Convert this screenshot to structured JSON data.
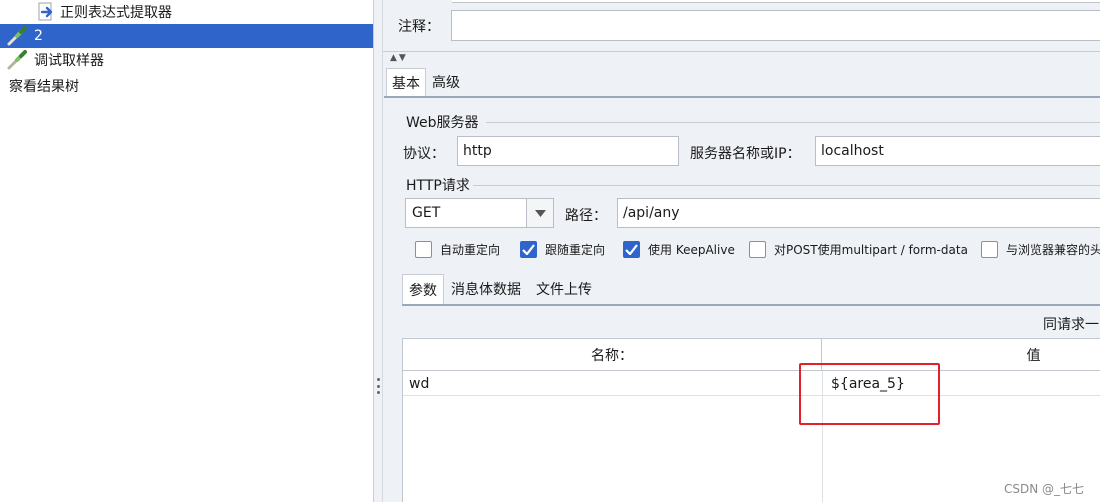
{
  "tree": {
    "items": [
      {
        "label": "正则表达式提取器",
        "icon": "arrow-right-icon"
      },
      {
        "label": "2",
        "icon": "pipette-icon",
        "selected": true
      },
      {
        "label": "调试取样器",
        "icon": "pipette-icon"
      },
      {
        "label": "察看结果树",
        "icon": ""
      }
    ]
  },
  "colors": {
    "selection": "#2f65ca",
    "highlight": "#e0232b",
    "panel_bg": "#eef1f5"
  },
  "comment": {
    "label": "注释：",
    "value": ""
  },
  "main_tabs": [
    {
      "label": "基本"
    },
    {
      "label": "高级"
    }
  ],
  "web_server": {
    "title": "Web服务器",
    "protocol_label": "协议：",
    "protocol_value": "http",
    "server_label": "服务器名称或IP：",
    "server_value": "localhost"
  },
  "http_request": {
    "title": "HTTP请求",
    "method": "GET",
    "path_label": "路径：",
    "path_value": "/api/any"
  },
  "options": [
    {
      "label": "自动重定向",
      "checked": false
    },
    {
      "label": "跟随重定向",
      "checked": true
    },
    {
      "label": "使用 KeepAlive",
      "checked": true
    },
    {
      "label": "对POST使用multipart / form-data",
      "checked": false
    },
    {
      "label": "与浏览器兼容的头",
      "checked": false
    }
  ],
  "sub_tabs": [
    {
      "label": "参数"
    },
    {
      "label": "消息体数据"
    },
    {
      "label": "文件上传"
    }
  ],
  "send_with_request": "同请求一",
  "params_table": {
    "headers": {
      "name": "名称：",
      "value": "值"
    },
    "rows": [
      {
        "name": "wd",
        "value": "${area_5}"
      }
    ]
  },
  "watermark": "CSDN @_七七"
}
